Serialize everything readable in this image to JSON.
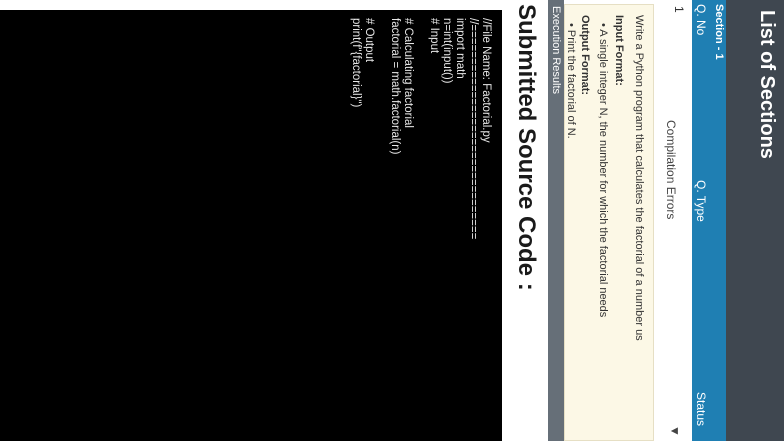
{
  "header": {
    "title": "List of Sections"
  },
  "section": {
    "label": "Section - 1"
  },
  "table": {
    "columns": [
      "Q. No",
      "Q. Type",
      "Status"
    ],
    "row": {
      "number": "1",
      "status": "Compilation Errors"
    }
  },
  "question": {
    "description": "Write a Python program that calculates the factorial of a number us",
    "input_heading": "Input Format:",
    "input_text": "• A single integer N, the number for which the factorial needs",
    "output_heading": "Output Format:",
    "output_text": "• Print the factorial of N."
  },
  "execution_tab": {
    "label": "Execution Results"
  },
  "source": {
    "heading": "Submitted Source Code :",
    "lines": [
      "//File Name: Factorial.py",
      "//================================",
      "import math",
      "n=int(input())",
      "# Input",
      "",
      "# Calculating factorial",
      "factorial = math.factorial(n)",
      "",
      "# Output",
      "print(f\"{factorial}\")"
    ]
  }
}
